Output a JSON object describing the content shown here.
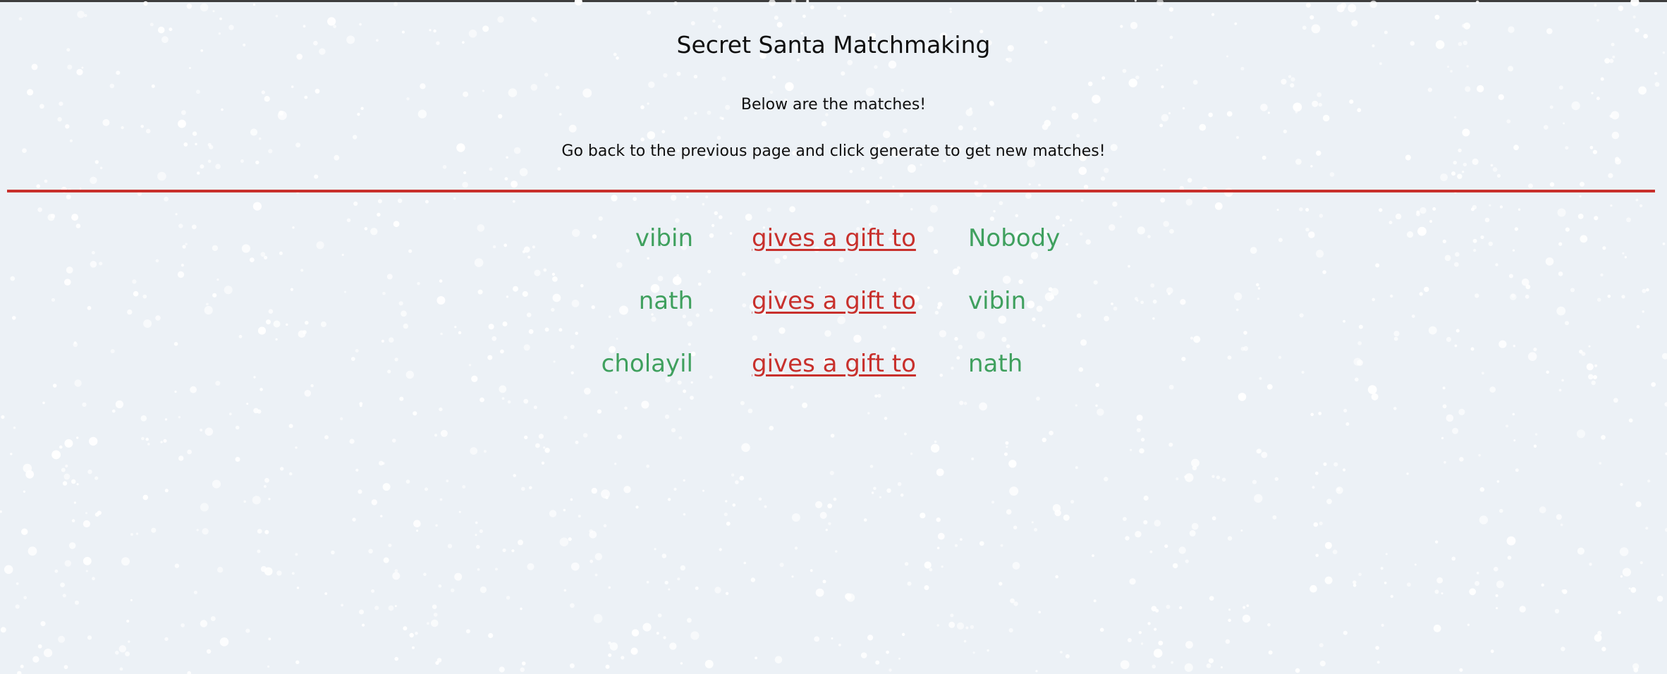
{
  "page": {
    "title": "Secret Santa Matchmaking",
    "subtitle_matches": "Below are the matches!",
    "subtitle_instructions": "Go back to the previous page and click generate to get new matches!"
  },
  "colors": {
    "background": "#ecf1f6",
    "accent_red": "#c8302c",
    "name_green": "#3fa05e",
    "snow": "#ffffff"
  },
  "matches": [
    {
      "giver": "vibin",
      "action": "gives a gift to",
      "receiver": "Nobody"
    },
    {
      "giver": "nath",
      "action": "gives a gift to",
      "receiver": "vibin"
    },
    {
      "giver": "cholayil",
      "action": "gives a gift to",
      "receiver": "nath"
    }
  ]
}
